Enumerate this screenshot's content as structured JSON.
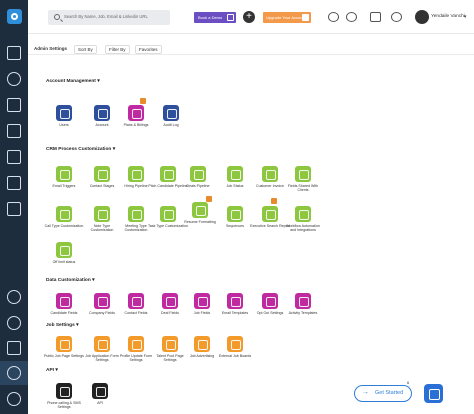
{
  "topbar": {
    "search_placeholder": "Search By Name, Job, Email & Linkedin URL",
    "demo_label": "Book a Demo",
    "upgrade_label": "Upgrade Your Account",
    "user_name": "Yendaile Vanchi"
  },
  "subbar": {
    "title": "Admin Settings",
    "sort_label": "Sort By",
    "filter_label": "Filter By",
    "favorites_label": "Favorites"
  },
  "sections": {
    "account": "Account Management",
    "crm": "CRM Process Customization",
    "data": "Data Customization",
    "job": "Job Settings",
    "api": "API"
  },
  "account_items": [
    "Users",
    "Account",
    "Plans & Billings",
    "Audit Log"
  ],
  "crm_items": [
    "Email Triggers",
    "Contact Stages",
    "Hiring Pipeline",
    "Pitch Candidate Pipeline",
    "Deals Pipeline",
    "Job Status",
    "Customer Invoice",
    "Fields Shared With Clients",
    "Call Type Customization",
    "Note Type Customization",
    "Meeting Type Customization",
    "Task Type Customization",
    "Resume Formatting",
    "Sequences",
    "Executive Search Report",
    "Workflow Automation and Integrations",
    "Off limit status"
  ],
  "data_items": [
    "Candidate Fields",
    "Company Fields",
    "Contact Fields",
    "Deal Fields",
    "Job Fields",
    "Email Templates",
    "Opt Out Settings",
    "Activity Templates"
  ],
  "job_items": [
    "Public Job Page Settings",
    "Job Application Form Settings",
    "Profile Update Form Settings",
    "Talent Pool Page Settings",
    "Job Advertising",
    "External Job Boards"
  ],
  "api_items": [
    "Phone calling & SMS Settings",
    "API"
  ],
  "footer": {
    "get_started": "Get Started",
    "count": "6"
  },
  "colors": {
    "sidebar": "#1d2d3e",
    "crm_green": "#8dc63f",
    "account_blue": "#2e4f9c",
    "data_magenta": "#c02aa0",
    "job_orange": "#f29b2b",
    "accent_blue": "#2f7fd8",
    "badge_orange": "#e98b2c"
  }
}
